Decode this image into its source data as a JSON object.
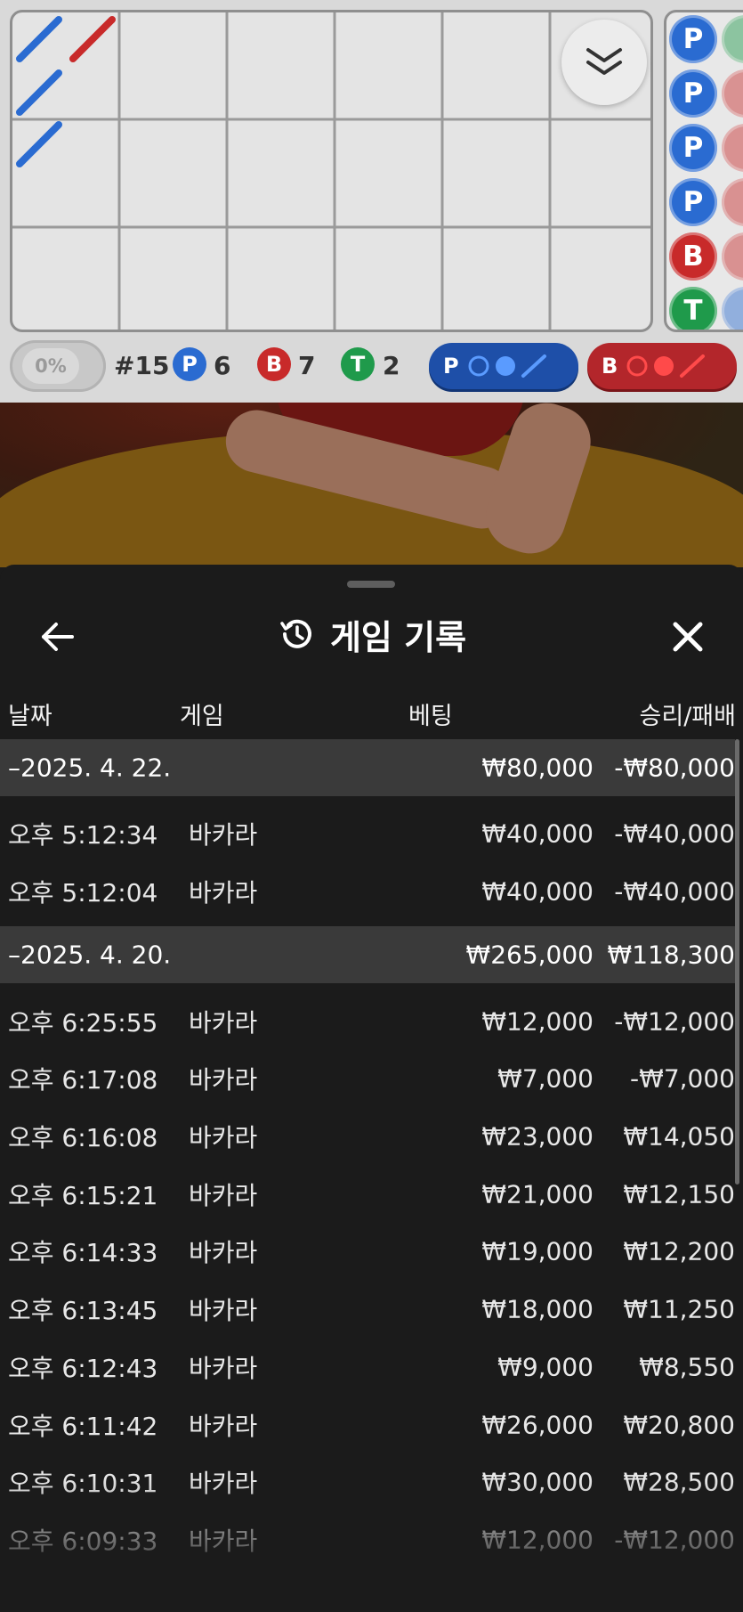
{
  "scoreboard": {
    "percent_label": "0%",
    "round_label": "#15",
    "player": {
      "letter": "P",
      "count": "6",
      "color": "#2a6bd1"
    },
    "banker": {
      "letter": "B",
      "count": "7",
      "color": "#c82a2a"
    },
    "tie": {
      "letter": "T",
      "count": "2",
      "color": "#1f9a4b"
    },
    "player_ask_label": "P",
    "banker_ask_label": "B",
    "bead_column": [
      "P",
      "P",
      "P",
      "P",
      "B",
      "T"
    ]
  },
  "panel": {
    "title": "게임 기록",
    "columns": {
      "date": "날짜",
      "game": "게임",
      "bet": "베팅",
      "winloss": "승리/패배"
    },
    "groups": [
      {
        "date": "–2025. 4. 22.",
        "bet": "₩80,000",
        "winloss": "-₩80,000",
        "items": [
          {
            "time": "오후 5:12:34",
            "game": "바카라",
            "bet": "₩40,000",
            "winloss": "-₩40,000"
          },
          {
            "time": "오후 5:12:04",
            "game": "바카라",
            "bet": "₩40,000",
            "winloss": "-₩40,000"
          }
        ]
      },
      {
        "date": "–2025. 4. 20.",
        "bet": "₩265,000",
        "winloss": "₩118,300",
        "items": [
          {
            "time": "오후 6:25:55",
            "game": "바카라",
            "bet": "₩12,000",
            "winloss": "-₩12,000"
          },
          {
            "time": "오후 6:17:08",
            "game": "바카라",
            "bet": "₩7,000",
            "winloss": "-₩7,000"
          },
          {
            "time": "오후 6:16:08",
            "game": "바카라",
            "bet": "₩23,000",
            "winloss": "₩14,050"
          },
          {
            "time": "오후 6:15:21",
            "game": "바카라",
            "bet": "₩21,000",
            "winloss": "₩12,150"
          },
          {
            "time": "오후 6:14:33",
            "game": "바카라",
            "bet": "₩19,000",
            "winloss": "₩12,200"
          },
          {
            "time": "오후 6:13:45",
            "game": "바카라",
            "bet": "₩18,000",
            "winloss": "₩11,250"
          },
          {
            "time": "오후 6:12:43",
            "game": "바카라",
            "bet": "₩9,000",
            "winloss": "₩8,550"
          },
          {
            "time": "오후 6:11:42",
            "game": "바카라",
            "bet": "₩26,000",
            "winloss": "₩20,800"
          },
          {
            "time": "오후 6:10:31",
            "game": "바카라",
            "bet": "₩30,000",
            "winloss": "₩28,500"
          },
          {
            "time": "오후 6:09:33",
            "game": "바카라",
            "bet": "₩12,000",
            "winloss": "-₩12,000"
          }
        ]
      }
    ]
  }
}
